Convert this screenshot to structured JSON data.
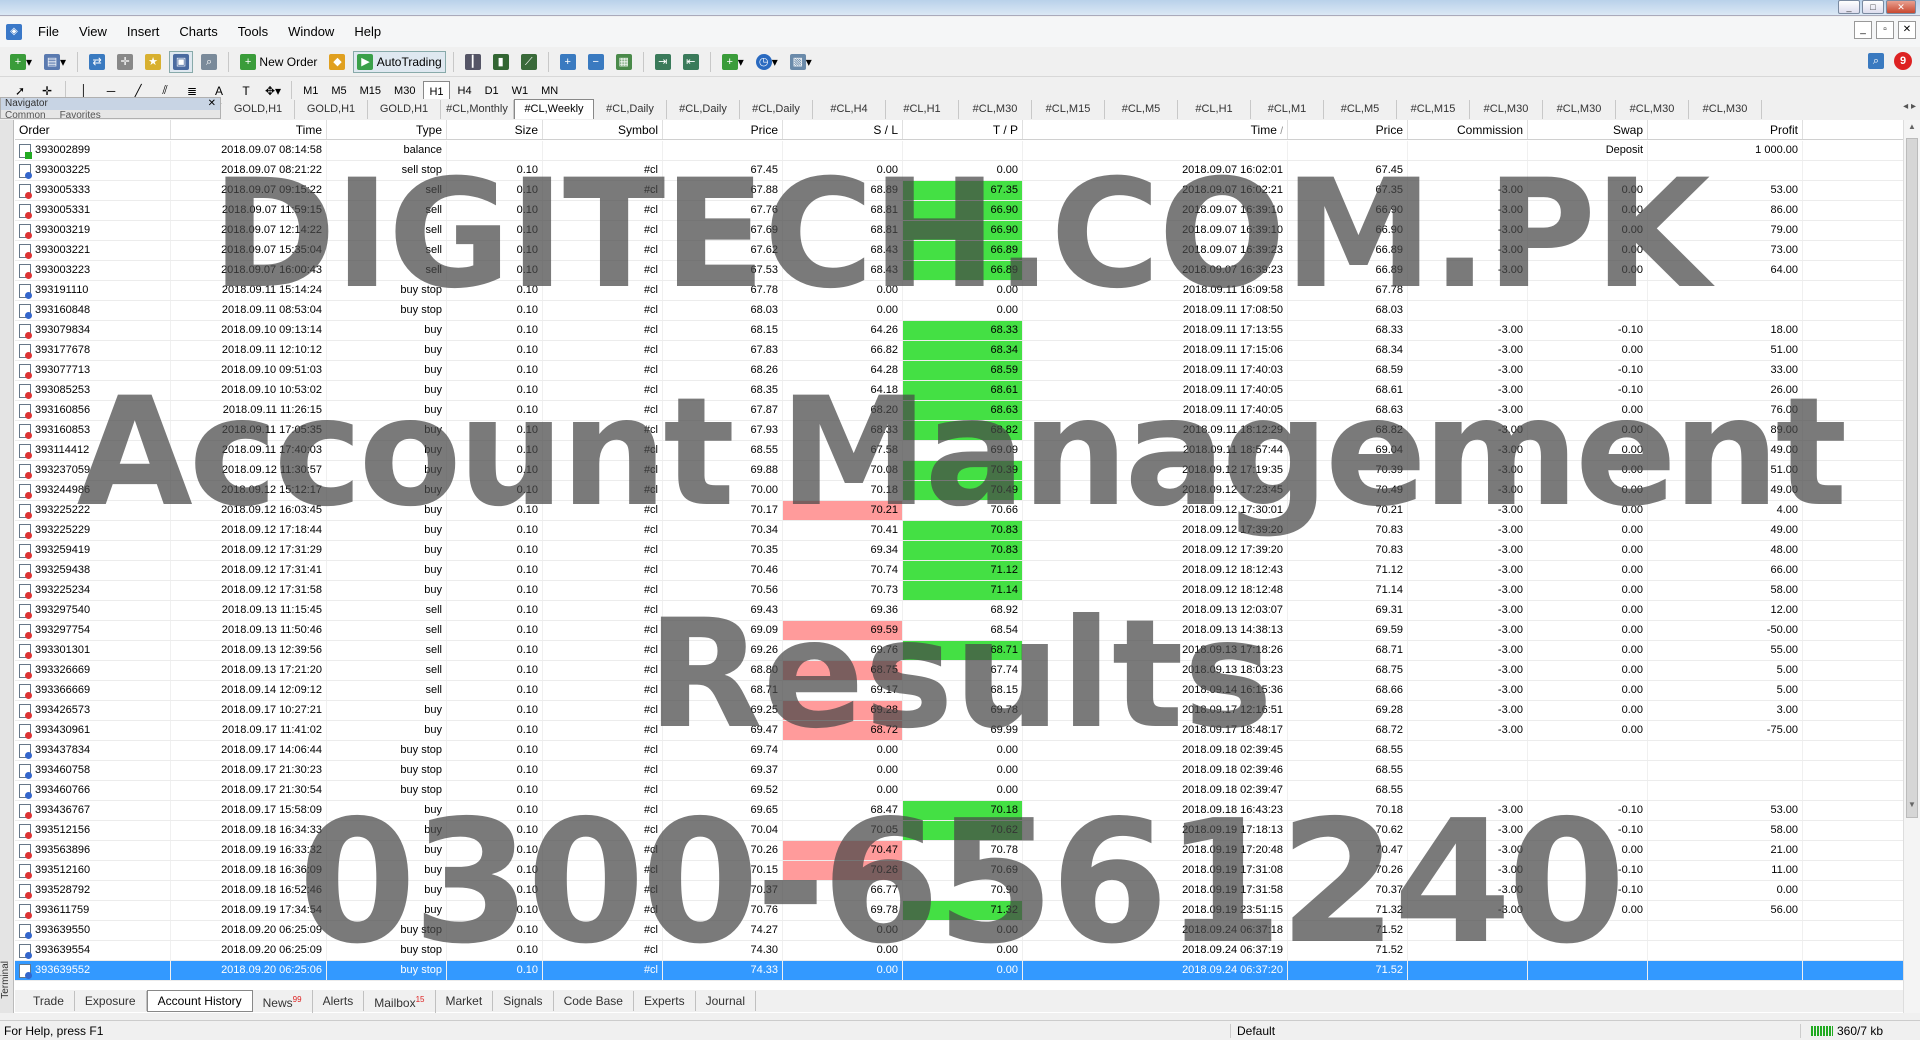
{
  "menu": {
    "items": [
      "File",
      "View",
      "Insert",
      "Charts",
      "Tools",
      "Window",
      "Help"
    ]
  },
  "toolbar": {
    "new_order_label": "New Order",
    "autotrading_label": "AutoTrading",
    "timeframes": [
      "M1",
      "M5",
      "M15",
      "M30",
      "H1",
      "H4",
      "D1",
      "W1",
      "MN"
    ],
    "notification_count": "9"
  },
  "navigator": {
    "title": "Navigator",
    "tabs": [
      "Common",
      "Favorites"
    ]
  },
  "chart_tabs": [
    "GOLD,H1",
    "GOLD,H1",
    "GOLD,H1",
    "#CL,Monthly",
    "#CL,Weekly",
    "#CL,Daily",
    "#CL,Daily",
    "#CL,Daily",
    "#CL,H4",
    "#CL,H1",
    "#CL,M30",
    "#CL,M15",
    "#CL,M5",
    "#CL,H1",
    "#CL,M1",
    "#CL,M5",
    "#CL,M15",
    "#CL,M30",
    "#CL,M30",
    "#CL,M30",
    "#CL,M30"
  ],
  "active_chart_tab": "#CL,Weekly",
  "columns": [
    "Order",
    "Time",
    "Type",
    "Size",
    "Symbol",
    "Price",
    "S / L",
    "T / P",
    "Time",
    "Price",
    "Commission",
    "Swap",
    "Profit"
  ],
  "sort_indicator": "/",
  "rows": [
    {
      "order": "393002899",
      "time": "2018.09.07 08:14:58",
      "type": "balance",
      "size": "",
      "symbol": "",
      "price": "",
      "sl": "",
      "tp": "",
      "ctime": "",
      "cprice": "",
      "comm": "",
      "swap": "Deposit",
      "profit": "1 000.00",
      "hit": ""
    },
    {
      "order": "393003225",
      "time": "2018.09.07 08:21:22",
      "type": "sell stop",
      "size": "0.10",
      "symbol": "#cl",
      "price": "67.45",
      "sl": "0.00",
      "tp": "0.00",
      "ctime": "2018.09.07 16:02:01",
      "cprice": "67.45",
      "comm": "",
      "swap": "",
      "profit": "",
      "hit": ""
    },
    {
      "order": "393005333",
      "time": "2018.09.07 09:15:22",
      "type": "sell",
      "size": "0.10",
      "symbol": "#cl",
      "price": "67.88",
      "sl": "68.89",
      "tp": "67.35",
      "ctime": "2018.09.07 16:02:21",
      "cprice": "67.35",
      "comm": "-3.00",
      "swap": "0.00",
      "profit": "53.00",
      "hit": "tp"
    },
    {
      "order": "393005331",
      "time": "2018.09.07 11:59:15",
      "type": "sell",
      "size": "0.10",
      "symbol": "#cl",
      "price": "67.76",
      "sl": "68.81",
      "tp": "66.90",
      "ctime": "2018.09.07 16:39:10",
      "cprice": "66.90",
      "comm": "-3.00",
      "swap": "0.00",
      "profit": "86.00",
      "hit": "tp"
    },
    {
      "order": "393003219",
      "time": "2018.09.07 12:14:22",
      "type": "sell",
      "size": "0.10",
      "symbol": "#cl",
      "price": "67.69",
      "sl": "68.81",
      "tp": "66.90",
      "ctime": "2018.09.07 16:39:10",
      "cprice": "66.90",
      "comm": "-3.00",
      "swap": "0.00",
      "profit": "79.00",
      "hit": "tp"
    },
    {
      "order": "393003221",
      "time": "2018.09.07 15:35:04",
      "type": "sell",
      "size": "0.10",
      "symbol": "#cl",
      "price": "67.62",
      "sl": "68.43",
      "tp": "66.89",
      "ctime": "2018.09.07 16:39:23",
      "cprice": "66.89",
      "comm": "-3.00",
      "swap": "0.00",
      "profit": "73.00",
      "hit": "tp"
    },
    {
      "order": "393003223",
      "time": "2018.09.07 16:00:43",
      "type": "sell",
      "size": "0.10",
      "symbol": "#cl",
      "price": "67.53",
      "sl": "68.43",
      "tp": "66.89",
      "ctime": "2018.09.07 16:39:23",
      "cprice": "66.89",
      "comm": "-3.00",
      "swap": "0.00",
      "profit": "64.00",
      "hit": "tp"
    },
    {
      "order": "393191110",
      "time": "2018.09.11 15:14:24",
      "type": "buy stop",
      "size": "0.10",
      "symbol": "#cl",
      "price": "67.78",
      "sl": "0.00",
      "tp": "0.00",
      "ctime": "2018.09.11 16:09:58",
      "cprice": "67.78",
      "comm": "",
      "swap": "",
      "profit": "",
      "hit": ""
    },
    {
      "order": "393160848",
      "time": "2018.09.11 08:53:04",
      "type": "buy stop",
      "size": "0.10",
      "symbol": "#cl",
      "price": "68.03",
      "sl": "0.00",
      "tp": "0.00",
      "ctime": "2018.09.11 17:08:50",
      "cprice": "68.03",
      "comm": "",
      "swap": "",
      "profit": "",
      "hit": ""
    },
    {
      "order": "393079834",
      "time": "2018.09.10 09:13:14",
      "type": "buy",
      "size": "0.10",
      "symbol": "#cl",
      "price": "68.15",
      "sl": "64.26",
      "tp": "68.33",
      "ctime": "2018.09.11 17:13:55",
      "cprice": "68.33",
      "comm": "-3.00",
      "swap": "-0.10",
      "profit": "18.00",
      "hit": "tp"
    },
    {
      "order": "393177678",
      "time": "2018.09.11 12:10:12",
      "type": "buy",
      "size": "0.10",
      "symbol": "#cl",
      "price": "67.83",
      "sl": "66.82",
      "tp": "68.34",
      "ctime": "2018.09.11 17:15:06",
      "cprice": "68.34",
      "comm": "-3.00",
      "swap": "0.00",
      "profit": "51.00",
      "hit": "tp"
    },
    {
      "order": "393077713",
      "time": "2018.09.10 09:51:03",
      "type": "buy",
      "size": "0.10",
      "symbol": "#cl",
      "price": "68.26",
      "sl": "64.28",
      "tp": "68.59",
      "ctime": "2018.09.11 17:40:03",
      "cprice": "68.59",
      "comm": "-3.00",
      "swap": "-0.10",
      "profit": "33.00",
      "hit": "tp"
    },
    {
      "order": "393085253",
      "time": "2018.09.10 10:53:02",
      "type": "buy",
      "size": "0.10",
      "symbol": "#cl",
      "price": "68.35",
      "sl": "64.18",
      "tp": "68.61",
      "ctime": "2018.09.11 17:40:05",
      "cprice": "68.61",
      "comm": "-3.00",
      "swap": "-0.10",
      "profit": "26.00",
      "hit": "tp"
    },
    {
      "order": "393160856",
      "time": "2018.09.11 11:26:15",
      "type": "buy",
      "size": "0.10",
      "symbol": "#cl",
      "price": "67.87",
      "sl": "68.20",
      "tp": "68.63",
      "ctime": "2018.09.11 17:40:05",
      "cprice": "68.63",
      "comm": "-3.00",
      "swap": "0.00",
      "profit": "76.00",
      "hit": "tp"
    },
    {
      "order": "393160853",
      "time": "2018.09.11 17:05:35",
      "type": "buy",
      "size": "0.10",
      "symbol": "#cl",
      "price": "67.93",
      "sl": "68.33",
      "tp": "68.82",
      "ctime": "2018.09.11 18:12:29",
      "cprice": "68.82",
      "comm": "-3.00",
      "swap": "0.00",
      "profit": "89.00",
      "hit": "tp"
    },
    {
      "order": "393114412",
      "time": "2018.09.11 17:40:03",
      "type": "buy",
      "size": "0.10",
      "symbol": "#cl",
      "price": "68.55",
      "sl": "67.58",
      "tp": "69.09",
      "ctime": "2018.09.11 18:57:44",
      "cprice": "69.04",
      "comm": "-3.00",
      "swap": "0.00",
      "profit": "49.00",
      "hit": ""
    },
    {
      "order": "393237059",
      "time": "2018.09.12 11:30:57",
      "type": "buy",
      "size": "0.10",
      "symbol": "#cl",
      "price": "69.88",
      "sl": "70.08",
      "tp": "70.39",
      "ctime": "2018.09.12 17:19:35",
      "cprice": "70.39",
      "comm": "-3.00",
      "swap": "0.00",
      "profit": "51.00",
      "hit": "tp"
    },
    {
      "order": "393244986",
      "time": "2018.09.12 15:12:17",
      "type": "buy",
      "size": "0.10",
      "symbol": "#cl",
      "price": "70.00",
      "sl": "70.18",
      "tp": "70.49",
      "ctime": "2018.09.12 17:23:45",
      "cprice": "70.49",
      "comm": "-3.00",
      "swap": "0.00",
      "profit": "49.00",
      "hit": "tp"
    },
    {
      "order": "393225222",
      "time": "2018.09.12 16:03:45",
      "type": "buy",
      "size": "0.10",
      "symbol": "#cl",
      "price": "70.17",
      "sl": "70.21",
      "tp": "70.66",
      "ctime": "2018.09.12 17:30:01",
      "cprice": "70.21",
      "comm": "-3.00",
      "swap": "0.00",
      "profit": "4.00",
      "hit": "sl"
    },
    {
      "order": "393225229",
      "time": "2018.09.12 17:18:44",
      "type": "buy",
      "size": "0.10",
      "symbol": "#cl",
      "price": "70.34",
      "sl": "70.41",
      "tp": "70.83",
      "ctime": "2018.09.12 17:39:20",
      "cprice": "70.83",
      "comm": "-3.00",
      "swap": "0.00",
      "profit": "49.00",
      "hit": "tp"
    },
    {
      "order": "393259419",
      "time": "2018.09.12 17:31:29",
      "type": "buy",
      "size": "0.10",
      "symbol": "#cl",
      "price": "70.35",
      "sl": "69.34",
      "tp": "70.83",
      "ctime": "2018.09.12 17:39:20",
      "cprice": "70.83",
      "comm": "-3.00",
      "swap": "0.00",
      "profit": "48.00",
      "hit": "tp"
    },
    {
      "order": "393259438",
      "time": "2018.09.12 17:31:41",
      "type": "buy",
      "size": "0.10",
      "symbol": "#cl",
      "price": "70.46",
      "sl": "70.74",
      "tp": "71.12",
      "ctime": "2018.09.12 18:12:43",
      "cprice": "71.12",
      "comm": "-3.00",
      "swap": "0.00",
      "profit": "66.00",
      "hit": "tp"
    },
    {
      "order": "393225234",
      "time": "2018.09.12 17:31:58",
      "type": "buy",
      "size": "0.10",
      "symbol": "#cl",
      "price": "70.56",
      "sl": "70.73",
      "tp": "71.14",
      "ctime": "2018.09.12 18:12:48",
      "cprice": "71.14",
      "comm": "-3.00",
      "swap": "0.00",
      "profit": "58.00",
      "hit": "tp"
    },
    {
      "order": "393297540",
      "time": "2018.09.13 11:15:45",
      "type": "sell",
      "size": "0.10",
      "symbol": "#cl",
      "price": "69.43",
      "sl": "69.36",
      "tp": "68.92",
      "ctime": "2018.09.13 12:03:07",
      "cprice": "69.31",
      "comm": "-3.00",
      "swap": "0.00",
      "profit": "12.00",
      "hit": ""
    },
    {
      "order": "393297754",
      "time": "2018.09.13 11:50:46",
      "type": "sell",
      "size": "0.10",
      "symbol": "#cl",
      "price": "69.09",
      "sl": "69.59",
      "tp": "68.54",
      "ctime": "2018.09.13 14:38:13",
      "cprice": "69.59",
      "comm": "-3.00",
      "swap": "0.00",
      "profit": "-50.00",
      "hit": "sl"
    },
    {
      "order": "393301301",
      "time": "2018.09.13 12:39:56",
      "type": "sell",
      "size": "0.10",
      "symbol": "#cl",
      "price": "69.26",
      "sl": "69.76",
      "tp": "68.71",
      "ctime": "2018.09.13 17:18:26",
      "cprice": "68.71",
      "comm": "-3.00",
      "swap": "0.00",
      "profit": "55.00",
      "hit": "tp"
    },
    {
      "order": "393326669",
      "time": "2018.09.13 17:21:20",
      "type": "sell",
      "size": "0.10",
      "symbol": "#cl",
      "price": "68.80",
      "sl": "68.75",
      "tp": "67.74",
      "ctime": "2018.09.13 18:03:23",
      "cprice": "68.75",
      "comm": "-3.00",
      "swap": "0.00",
      "profit": "5.00",
      "hit": "sl"
    },
    {
      "order": "393366669",
      "time": "2018.09.14 12:09:12",
      "type": "sell",
      "size": "0.10",
      "symbol": "#cl",
      "price": "68.71",
      "sl": "69.17",
      "tp": "68.15",
      "ctime": "2018.09.14 16:15:36",
      "cprice": "68.66",
      "comm": "-3.00",
      "swap": "0.00",
      "profit": "5.00",
      "hit": ""
    },
    {
      "order": "393426573",
      "time": "2018.09.17 10:27:21",
      "type": "buy",
      "size": "0.10",
      "symbol": "#cl",
      "price": "69.25",
      "sl": "69.28",
      "tp": "69.78",
      "ctime": "2018.09.17 12:16:51",
      "cprice": "69.28",
      "comm": "-3.00",
      "swap": "0.00",
      "profit": "3.00",
      "hit": "sl"
    },
    {
      "order": "393430961",
      "time": "2018.09.17 11:41:02",
      "type": "buy",
      "size": "0.10",
      "symbol": "#cl",
      "price": "69.47",
      "sl": "68.72",
      "tp": "69.99",
      "ctime": "2018.09.17 18:48:17",
      "cprice": "68.72",
      "comm": "-3.00",
      "swap": "0.00",
      "profit": "-75.00",
      "hit": "sl"
    },
    {
      "order": "393437834",
      "time": "2018.09.17 14:06:44",
      "type": "buy stop",
      "size": "0.10",
      "symbol": "#cl",
      "price": "69.74",
      "sl": "0.00",
      "tp": "0.00",
      "ctime": "2018.09.18 02:39:45",
      "cprice": "68.55",
      "comm": "",
      "swap": "",
      "profit": "",
      "hit": ""
    },
    {
      "order": "393460758",
      "time": "2018.09.17 21:30:23",
      "type": "buy stop",
      "size": "0.10",
      "symbol": "#cl",
      "price": "69.37",
      "sl": "0.00",
      "tp": "0.00",
      "ctime": "2018.09.18 02:39:46",
      "cprice": "68.55",
      "comm": "",
      "swap": "",
      "profit": "",
      "hit": ""
    },
    {
      "order": "393460766",
      "time": "2018.09.17 21:30:54",
      "type": "buy stop",
      "size": "0.10",
      "symbol": "#cl",
      "price": "69.52",
      "sl": "0.00",
      "tp": "0.00",
      "ctime": "2018.09.18 02:39:47",
      "cprice": "68.55",
      "comm": "",
      "swap": "",
      "profit": "",
      "hit": ""
    },
    {
      "order": "393436767",
      "time": "2018.09.17 15:58:09",
      "type": "buy",
      "size": "0.10",
      "symbol": "#cl",
      "price": "69.65",
      "sl": "68.47",
      "tp": "70.18",
      "ctime": "2018.09.18 16:43:23",
      "cprice": "70.18",
      "comm": "-3.00",
      "swap": "-0.10",
      "profit": "53.00",
      "hit": "tp"
    },
    {
      "order": "393512156",
      "time": "2018.09.18 16:34:33",
      "type": "buy",
      "size": "0.10",
      "symbol": "#cl",
      "price": "70.04",
      "sl": "70.05",
      "tp": "70.62",
      "ctime": "2018.09.19 17:18:13",
      "cprice": "70.62",
      "comm": "-3.00",
      "swap": "-0.10",
      "profit": "58.00",
      "hit": "tp"
    },
    {
      "order": "393563896",
      "time": "2018.09.19 16:33:32",
      "type": "buy",
      "size": "0.10",
      "symbol": "#cl",
      "price": "70.26",
      "sl": "70.47",
      "tp": "70.78",
      "ctime": "2018.09.19 17:20:48",
      "cprice": "70.47",
      "comm": "-3.00",
      "swap": "0.00",
      "profit": "21.00",
      "hit": "sl"
    },
    {
      "order": "393512160",
      "time": "2018.09.18 16:36:09",
      "type": "buy",
      "size": "0.10",
      "symbol": "#cl",
      "price": "70.15",
      "sl": "70.26",
      "tp": "70.69",
      "ctime": "2018.09.19 17:31:08",
      "cprice": "70.26",
      "comm": "-3.00",
      "swap": "-0.10",
      "profit": "11.00",
      "hit": "sl"
    },
    {
      "order": "393528792",
      "time": "2018.09.18 16:52:46",
      "type": "buy",
      "size": "0.10",
      "symbol": "#cl",
      "price": "70.37",
      "sl": "66.77",
      "tp": "70.90",
      "ctime": "2018.09.19 17:31:58",
      "cprice": "70.37",
      "comm": "-3.00",
      "swap": "-0.10",
      "profit": "0.00",
      "hit": ""
    },
    {
      "order": "393611759",
      "time": "2018.09.19 17:34:54",
      "type": "buy",
      "size": "0.10",
      "symbol": "#cl",
      "price": "70.76",
      "sl": "69.78",
      "tp": "71.32",
      "ctime": "2018.09.19 23:51:15",
      "cprice": "71.32",
      "comm": "-3.00",
      "swap": "0.00",
      "profit": "56.00",
      "hit": "tp"
    },
    {
      "order": "393639550",
      "time": "2018.09.20 06:25:09",
      "type": "buy stop",
      "size": "0.10",
      "symbol": "#cl",
      "price": "74.27",
      "sl": "0.00",
      "tp": "0.00",
      "ctime": "2018.09.24 06:37:18",
      "cprice": "71.52",
      "comm": "",
      "swap": "",
      "profit": "",
      "hit": ""
    },
    {
      "order": "393639554",
      "time": "2018.09.20 06:25:09",
      "type": "buy stop",
      "size": "0.10",
      "symbol": "#cl",
      "price": "74.30",
      "sl": "0.00",
      "tp": "0.00",
      "ctime": "2018.09.24 06:37:19",
      "cprice": "71.52",
      "comm": "",
      "swap": "",
      "profit": "",
      "hit": ""
    },
    {
      "order": "393639552",
      "time": "2018.09.20 06:25:06",
      "type": "buy stop",
      "size": "0.10",
      "symbol": "#cl",
      "price": "74.33",
      "sl": "0.00",
      "tp": "0.00",
      "ctime": "2018.09.24 06:37:20",
      "cprice": "71.52",
      "comm": "",
      "swap": "",
      "profit": "",
      "hit": "",
      "selected": true
    }
  ],
  "bottom_tabs": [
    {
      "label": "Trade"
    },
    {
      "label": "Exposure"
    },
    {
      "label": "Account History",
      "active": true
    },
    {
      "label": "News",
      "badge": "99"
    },
    {
      "label": "Alerts"
    },
    {
      "label": "Mailbox",
      "badge": "15"
    },
    {
      "label": "Market"
    },
    {
      "label": "Signals"
    },
    {
      "label": "Code Base"
    },
    {
      "label": "Experts"
    },
    {
      "label": "Journal"
    }
  ],
  "terminal_label": "Terminal",
  "status": {
    "help": "For Help, press F1",
    "profile": "Default",
    "connection": "360/7 kb"
  },
  "watermark": {
    "line1": "DIGITECH.COM.PK",
    "line2": "Account Management",
    "line3": "Results",
    "line4": "0300-6561240"
  },
  "colors": {
    "tp_hit": "#44e044",
    "sl_hit": "#ff9b9b",
    "selected_row": "#3399ff"
  }
}
